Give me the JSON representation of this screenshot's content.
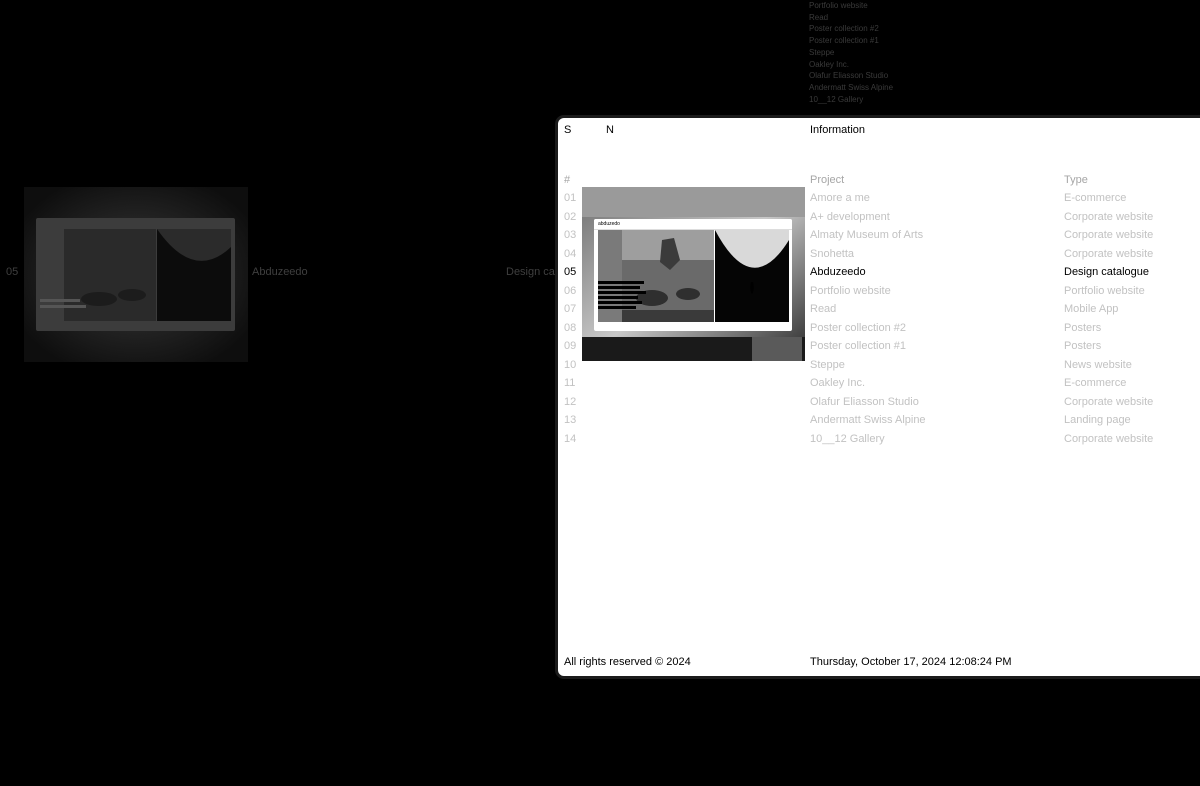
{
  "bg_list": [
    "Portfolio website",
    "Read",
    "Poster collection #2",
    "Poster collection #1",
    "Steppe",
    "Oakley Inc.",
    "Olafur Eliasson Studio",
    "Andermatt Swiss Alpine",
    "10__12 Gallery"
  ],
  "bg_row": {
    "number": "05",
    "project": "Abduzeedo",
    "type": "Design ca"
  },
  "header": {
    "logo_s": "S",
    "logo_n": "N",
    "information": "Information"
  },
  "table": {
    "headers": {
      "num": "#",
      "project": "Project",
      "type": "Type"
    },
    "rows": [
      {
        "num": "01",
        "project": "Amore a me",
        "type": "E-commerce"
      },
      {
        "num": "02",
        "project": "A+ development",
        "type": "Corporate website"
      },
      {
        "num": "03",
        "project": "Almaty Museum of Arts",
        "type": "Corporate website"
      },
      {
        "num": "04",
        "project": "Snohetta",
        "type": "Corporate website"
      },
      {
        "num": "05",
        "project": "Abduzeedo",
        "type": "Design catalogue"
      },
      {
        "num": "06",
        "project": "Portfolio website",
        "type": "Portfolio website"
      },
      {
        "num": "07",
        "project": "Read",
        "type": "Mobile App"
      },
      {
        "num": "08",
        "project": "Poster collection #2",
        "type": "Posters"
      },
      {
        "num": "09",
        "project": "Poster collection #1",
        "type": "Posters"
      },
      {
        "num": "10",
        "project": "Steppe",
        "type": "News website"
      },
      {
        "num": "11",
        "project": "Oakley Inc.",
        "type": "E-commerce"
      },
      {
        "num": "12",
        "project": "Olafur Eliasson Studio",
        "type": "Corporate website"
      },
      {
        "num": "13",
        "project": "Andermatt Swiss Alpine",
        "type": "Landing page"
      },
      {
        "num": "14",
        "project": "10__12 Gallery",
        "type": "Corporate website"
      }
    ],
    "active_index": 4
  },
  "footer": {
    "rights": "All rights reserved © 2024",
    "datetime": "Thursday, October 17, 2024 12:08:24 PM"
  },
  "preview": {
    "logo": "abduzedo"
  }
}
